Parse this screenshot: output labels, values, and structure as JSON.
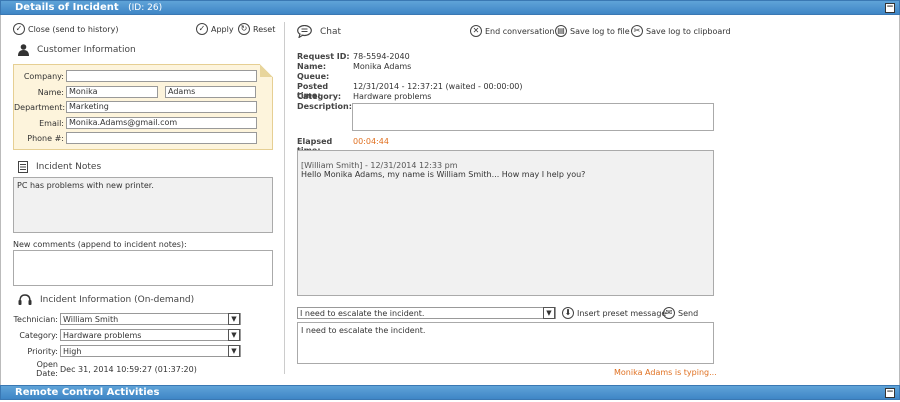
{
  "header": {
    "title": "Details of Incident",
    "id_text": "(ID: 26)",
    "collapse_glyph": "−"
  },
  "toolbar": {
    "close_label": "Close (send to history)",
    "apply_label": "Apply",
    "reset_label": "Reset"
  },
  "customer": {
    "section_title": "Customer Information",
    "company_label": "Company:",
    "company_value": "",
    "name_label": "Name:",
    "first_name": "Monika",
    "last_name": "Adams",
    "department_label": "Department:",
    "department_value": "Marketing",
    "email_label": "Email:",
    "email_value": "Monika.Adams@gmail.com",
    "phone_label": "Phone #:",
    "phone_value": ""
  },
  "notes": {
    "section_title": "Incident Notes",
    "notes_text": "PC has problems with new printer.",
    "new_comments_label": "New comments (append to incident notes):",
    "new_comments_value": ""
  },
  "incident_info": {
    "section_title": "Incident Information (On-demand)",
    "technician_label": "Technician:",
    "technician_value": "William Smith",
    "category_label": "Category:",
    "category_value": "Hardware problems",
    "priority_label": "Priority:",
    "priority_value": "High",
    "open_date_label": "Open Date:",
    "open_date_value": "Dec 31, 2014 10:59:27 (01:37:20)"
  },
  "chat": {
    "section_title": "Chat",
    "end_label": "End conversation",
    "save_file_label": "Save log to file",
    "save_clipboard_label": "Save log to clipboard",
    "request_id_label": "Request ID:",
    "request_id_value": "78-5594-2040",
    "name_label": "Name:",
    "name_value": "Monika Adams",
    "queue_label": "Queue:",
    "queue_value": "",
    "posted_label": "Posted time:",
    "posted_value": "12/31/2014 - 12:37:21 (waited - 00:00:00)",
    "category_label": "Category:",
    "category_value": "Hardware problems",
    "description_label": "Description:",
    "description_value": "",
    "elapsed_label": "Elapsed time:",
    "elapsed_value": "00:04:44",
    "log_header": "[William Smith] - 12/31/2014 12:33 pm",
    "log_message": "Hello Monika Adams, my name is William Smith... How may I help you?",
    "preset_value": "I need to escalate the incident.",
    "insert_preset_label": "Insert preset message",
    "send_label": "Send",
    "message_value": "I need to escalate the incident.",
    "typing_status": "Monika Adams is typing..."
  },
  "footer": {
    "title": "Remote Control Activities",
    "collapse_glyph": "−"
  },
  "colors": {
    "header_blue": "#4a90d0",
    "accent_orange": "#e07020",
    "customer_bg": "#fdf4dc"
  }
}
